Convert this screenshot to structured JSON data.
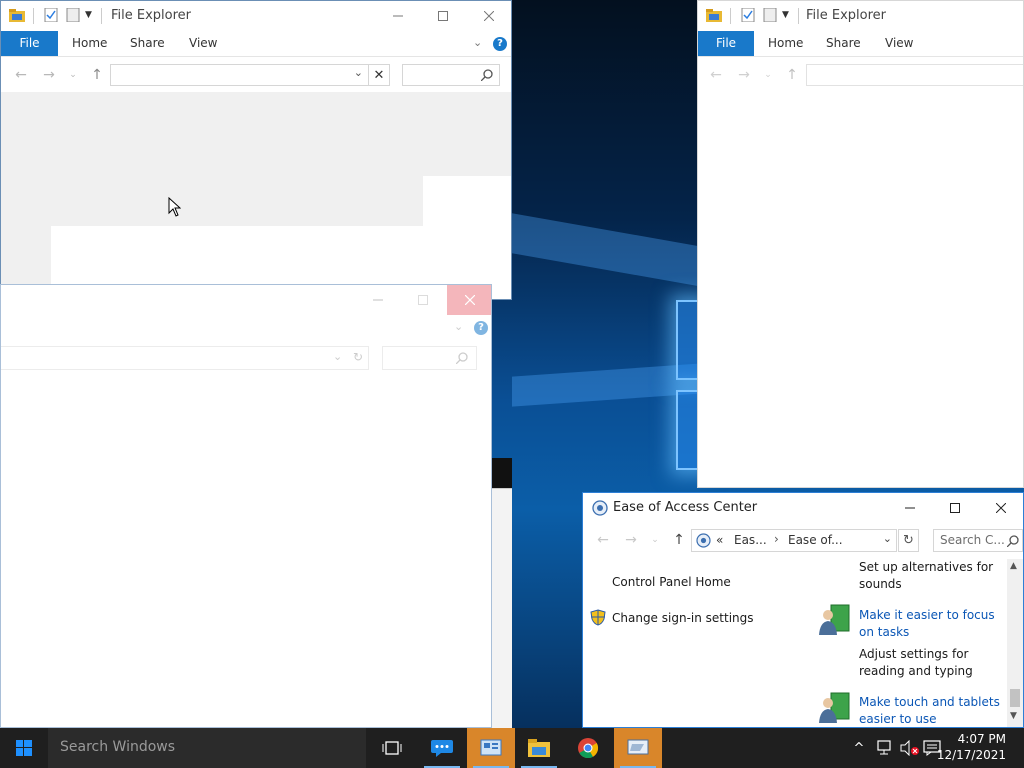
{
  "explorer_main": {
    "title": "File Explorer",
    "tabs": [
      "File",
      "Home",
      "Share",
      "View"
    ],
    "address_value": "",
    "search_placeholder": ""
  },
  "explorer_right": {
    "title": "File Explorer",
    "tabs": [
      "File",
      "Home",
      "Share",
      "View"
    ]
  },
  "ease": {
    "title": "Ease of Access Center",
    "breadcrumb": [
      "«",
      "Eas...",
      "Ease of..."
    ],
    "search_placeholder": "Search C...",
    "left_links": [
      "Control Panel Home",
      "Change sign-in settings"
    ],
    "right_items": [
      {
        "text": "Set up alternatives for sounds",
        "is_link": false
      },
      {
        "text": "Make it easier to focus on tasks",
        "is_link": true
      },
      {
        "text": "Adjust settings for reading and typing",
        "is_link": false
      },
      {
        "text": "Make touch and tablets easier to use",
        "is_link": true
      }
    ]
  },
  "taskbar": {
    "search_placeholder": "Search Windows",
    "time": "4:07 PM",
    "date": "12/17/2021"
  },
  "colors": {
    "accent": "#1979ca",
    "taskbar": "#1f1f1f",
    "highlight": "#d9862a",
    "close_hover": "#e81123"
  }
}
